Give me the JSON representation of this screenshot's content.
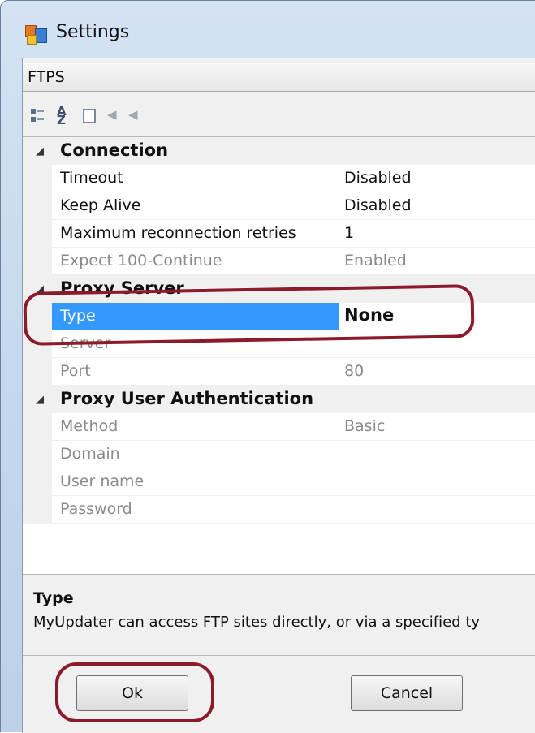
{
  "window": {
    "title": "Settings"
  },
  "combo": {
    "selected": "FTPS"
  },
  "toolbar": {
    "buttons": [
      "categorized-icon",
      "alphabetical-icon",
      "property-pages-icon",
      "events-icon",
      "events-alt-icon"
    ]
  },
  "grid": {
    "categories": {
      "connection": "Connection",
      "proxy_server": "Proxy Server",
      "proxy_auth": "Proxy User Authentication"
    },
    "connection": [
      {
        "name": "Timeout",
        "value": "Disabled"
      },
      {
        "name": "Keep Alive",
        "value": "Disabled"
      },
      {
        "name": "Maximum reconnection retries",
        "value": "1"
      },
      {
        "name": "Expect 100-Continue",
        "value": "Enabled"
      }
    ],
    "proxy_server": [
      {
        "name": "Type",
        "value": "None"
      },
      {
        "name": "Server",
        "value": ""
      },
      {
        "name": "Port",
        "value": "80"
      }
    ],
    "proxy_auth": [
      {
        "name": "Method",
        "value": "Basic"
      },
      {
        "name": "Domain",
        "value": ""
      },
      {
        "name": "User name",
        "value": ""
      },
      {
        "name": "Password",
        "value": ""
      }
    ]
  },
  "description": {
    "title": "Type",
    "text": "MyUpdater can access FTP sites directly, or via a specified ty"
  },
  "buttons": {
    "ok": "Ok",
    "cancel": "Cancel"
  },
  "colors": {
    "selection": "#3399ff",
    "annotation": "#8b1a2b"
  }
}
